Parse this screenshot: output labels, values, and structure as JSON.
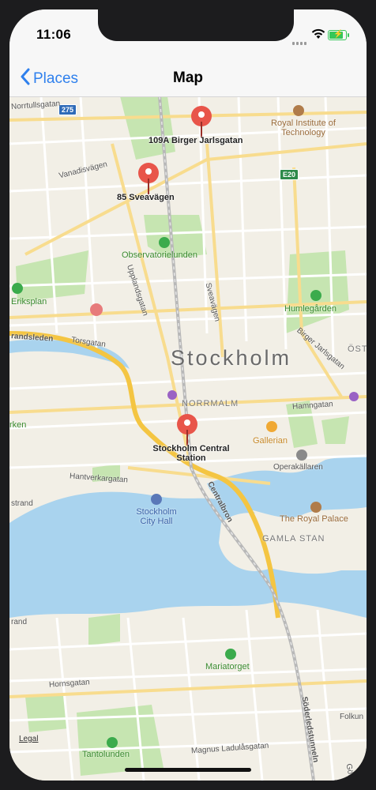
{
  "status": {
    "time": "11:06"
  },
  "nav": {
    "back_label": "Places",
    "title": "Map"
  },
  "pins": [
    {
      "label": "109A Birger Jarlsgatan"
    },
    {
      "label": "85 Sveavägen"
    },
    {
      "label": "Stockholm Central Station"
    }
  ],
  "map": {
    "city": "Stockholm",
    "districts": [
      "NORRMALM",
      "GAMLA STAN"
    ],
    "pois": {
      "kth": "Royal Institute of Technology",
      "observatorielunden": "Observatorielunden",
      "eriksplan": "Eriksplan",
      "humlegarden": "Humlegården",
      "gallerian": "Gallerian",
      "operakallaren": "Operakällaren",
      "royal_palace": "The Royal Palace",
      "city_hall": "Stockholm City Hall",
      "mariatorget": "Mariatorget",
      "tantolunden": "Tantolunden"
    },
    "streets": {
      "norrtull": "Norrtullsgatan",
      "vanadis": "Vanadisvägen",
      "upplands": "Upplandsgatan",
      "svea": "Sveavägen",
      "torsgatan": "Torsgatan",
      "birger": "Birger Jarlsgatan",
      "hamngatan": "Hamngatan",
      "hantverkar": "Hantverkargatan",
      "centralbron": "Centralbron",
      "hornsgatan": "Hornsgatan",
      "sodra": "Söderledstunneln",
      "magnus": "Magnus Ladulåsgatan",
      "folkun": "Folkun",
      "gotg": "Götg",
      "rand": "randsleden",
      "strand": "strand",
      "strand2": "rand",
      "parken": "rken",
      "ost": "ÖST"
    },
    "shields": [
      "275",
      "E20"
    ],
    "legal": "Legal"
  }
}
